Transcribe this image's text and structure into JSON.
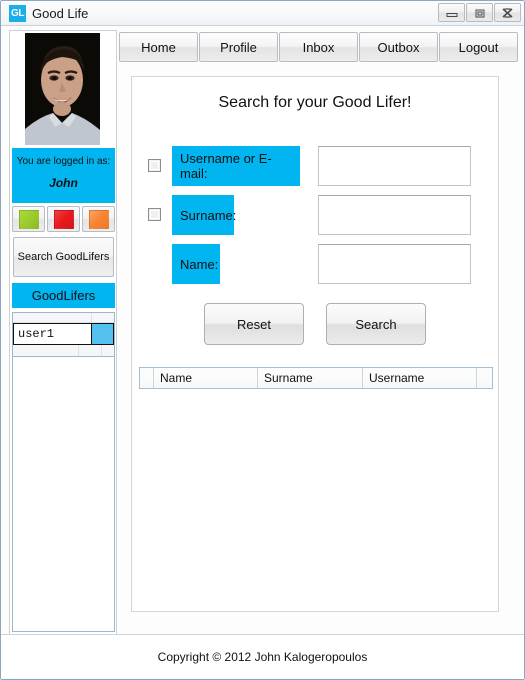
{
  "window": {
    "logo_text": "GL",
    "title": "Good Life",
    "controls": {
      "minimize": "minimize-icon",
      "restore": "restore-icon",
      "close": "close-icon"
    }
  },
  "nav": {
    "tabs": [
      {
        "label": "Home"
      },
      {
        "label": "Profile"
      },
      {
        "label": "Inbox"
      },
      {
        "label": "Outbox"
      },
      {
        "label": "Logout"
      }
    ]
  },
  "sidebar": {
    "avatar_alt": "user-photo",
    "logged_in_label": "You are logged in as:",
    "logged_in_user": "John",
    "color_buttons": [
      {
        "name": "green-status-button",
        "color": "#9ccb2e"
      },
      {
        "name": "red-status-button",
        "color": "#e8191c"
      },
      {
        "name": "orange-status-button",
        "color": "#f68433"
      }
    ],
    "search_goodlifers_label": "Search GoodLifers",
    "goodlifers_header": "GoodLifers",
    "goodlifers_list": [
      {
        "name": "user1",
        "color": "#54c0f0"
      }
    ]
  },
  "main": {
    "title": "Search for your Good Lifer!",
    "fields": [
      {
        "id": "username",
        "has_checkbox": true,
        "checked": false,
        "label": "Username or E-mail:",
        "value": "",
        "placeholder": ""
      },
      {
        "id": "surname",
        "has_checkbox": true,
        "checked": false,
        "label": "Surname:",
        "value": "",
        "placeholder": ""
      },
      {
        "id": "name",
        "has_checkbox": false,
        "checked": false,
        "label": "Name:",
        "value": "",
        "placeholder": ""
      }
    ],
    "buttons": {
      "reset": "Reset",
      "search": "Search"
    },
    "results_table": {
      "columns": [
        "Name",
        "Surname",
        "Username"
      ],
      "rows": []
    }
  },
  "footer": {
    "copyright": "Copyright © 2012 John Kalogeropoulos"
  },
  "theme": {
    "accent_blue": "#00b5f0",
    "logo_blue": "#1aaeea",
    "frame_border": "#8ba7bd"
  }
}
